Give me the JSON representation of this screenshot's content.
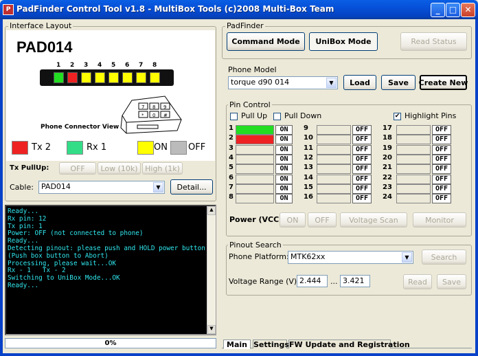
{
  "window": {
    "title": "PadFinder Control Tool v1.8 - MultiBox Tools (c)2008 Multi-Box Team",
    "app_icon": "padfinder-app-icon"
  },
  "interface_layout": {
    "label": "Interface Layout",
    "pad_name": "PAD014",
    "connector_pins": [
      "1",
      "2",
      "3",
      "4",
      "5",
      "6",
      "7",
      "8"
    ],
    "connector_colors": [
      "#22dd22",
      "#ee2222",
      "#ffff00",
      "#ffff00",
      "#ffff00",
      "#ffff00",
      "#ffff00",
      "#ffff00"
    ],
    "connector_caption": "Phone Connector View",
    "phone_keys": [
      "7",
      "8",
      "9",
      "*",
      "0",
      "#"
    ],
    "legend": [
      {
        "label": "Tx 2",
        "color": "#ee2222"
      },
      {
        "label": "Rx 1",
        "color": "#33dd88"
      },
      {
        "label": "ON",
        "color": "#ffff00"
      },
      {
        "label": "OFF",
        "color": "#bbbbbb"
      }
    ],
    "tx_pullup_label": "Tx PullUp:",
    "tx_pullup_buttons": [
      "OFF",
      "Low (10k)",
      "High (1k)"
    ],
    "cable_label": "Cable:",
    "cable_value": "PAD014",
    "detail_button": "Detail..."
  },
  "console": {
    "lines": "Ready...\nRx pin: 12\nTx pin: 1\nPower: OFF (not connected to phone)\nReady...\nDetecting pinout: please push and HOLD power button!\n(Push box button to Abort)\nProcessing, please wait...OK\nRx - 1   Tx - 2\nSwitching to UniBox Mode...OK\nReady..."
  },
  "progress": {
    "text": "0%",
    "value": 0
  },
  "padfinder": {
    "label": "PadFinder",
    "command_mode": "Command Mode",
    "unibox_mode": "UniBox Mode",
    "read_status": "Read Status"
  },
  "phone_model": {
    "label": "Phone Model",
    "value": "torque d90 014",
    "load": "Load",
    "save": "Save",
    "create_new": "Create New"
  },
  "pin_control": {
    "label": "Pin Control",
    "pull_up": "Pull Up",
    "pull_up_checked": false,
    "pull_down": "Pull Down",
    "pull_down_checked": false,
    "highlight_pins": "Highlight Pins",
    "highlight_checked": true,
    "pins_col1": [
      {
        "n": "1",
        "color": "#22dd22",
        "state": "ON"
      },
      {
        "n": "2",
        "color": "#ee2222",
        "state": "ON"
      },
      {
        "n": "3",
        "color": "#ece9d8",
        "state": "ON"
      },
      {
        "n": "4",
        "color": "#ece9d8",
        "state": "ON"
      },
      {
        "n": "5",
        "color": "#ece9d8",
        "state": "ON"
      },
      {
        "n": "6",
        "color": "#ece9d8",
        "state": "ON"
      },
      {
        "n": "7",
        "color": "#ece9d8",
        "state": "ON"
      },
      {
        "n": "8",
        "color": "#ece9d8",
        "state": "ON"
      }
    ],
    "pins_col2": [
      {
        "n": "9",
        "state": "OFF"
      },
      {
        "n": "10",
        "state": "OFF"
      },
      {
        "n": "11",
        "state": "OFF"
      },
      {
        "n": "12",
        "state": "OFF"
      },
      {
        "n": "13",
        "state": "OFF"
      },
      {
        "n": "14",
        "state": "OFF"
      },
      {
        "n": "15",
        "state": "OFF"
      },
      {
        "n": "16",
        "state": "OFF"
      }
    ],
    "pins_col3": [
      {
        "n": "17",
        "state": "OFF"
      },
      {
        "n": "18",
        "state": "OFF"
      },
      {
        "n": "19",
        "state": "OFF"
      },
      {
        "n": "20",
        "state": "OFF"
      },
      {
        "n": "21",
        "state": "OFF"
      },
      {
        "n": "22",
        "state": "OFF"
      },
      {
        "n": "23",
        "state": "OFF"
      },
      {
        "n": "24",
        "state": "OFF"
      }
    ],
    "power_label": "Power (VCC):",
    "power_on": "ON",
    "power_off": "OFF",
    "voltage_scan": "Voltage Scan",
    "monitor": "Monitor"
  },
  "pinout_search": {
    "label": "Pinout Search",
    "platform_label": "Phone Platform:",
    "platform_value": "MTK62xx",
    "search": "Search",
    "voltage_label": "Voltage Range (V):",
    "v_min": "2.444",
    "v_sep": "...",
    "v_max": "3.421",
    "read": "Read",
    "save": "Save"
  },
  "tabs": [
    "Main",
    "Settings",
    "FW Update and Registration"
  ]
}
